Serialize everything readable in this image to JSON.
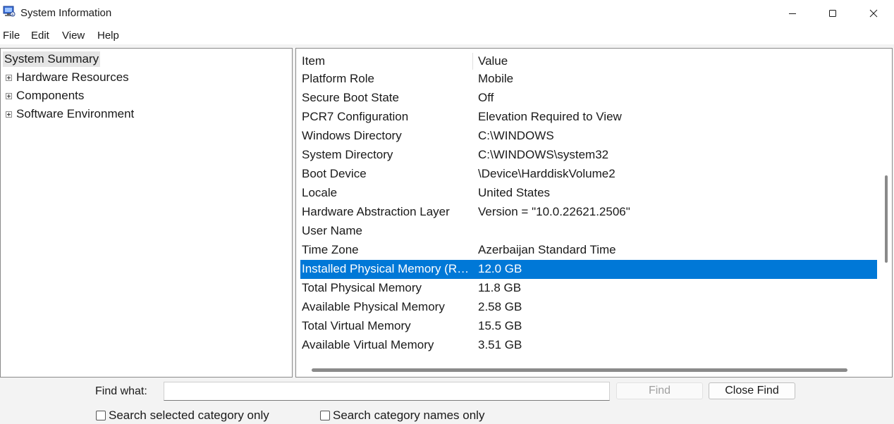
{
  "window": {
    "title": "System Information",
    "icon": "system-information-icon"
  },
  "menu": [
    "File",
    "Edit",
    "View",
    "Help"
  ],
  "tree": {
    "root": "System Summary",
    "children": [
      "Hardware Resources",
      "Components",
      "Software Environment"
    ]
  },
  "table": {
    "headers": {
      "item": "Item",
      "value": "Value"
    },
    "rows": [
      {
        "item": "Platform Role",
        "value": "Mobile"
      },
      {
        "item": "Secure Boot State",
        "value": "Off"
      },
      {
        "item": "PCR7 Configuration",
        "value": "Elevation Required to View"
      },
      {
        "item": "Windows Directory",
        "value": "C:\\WINDOWS"
      },
      {
        "item": "System Directory",
        "value": "C:\\WINDOWS\\system32"
      },
      {
        "item": "Boot Device",
        "value": "\\Device\\HarddiskVolume2"
      },
      {
        "item": "Locale",
        "value": "United States"
      },
      {
        "item": "Hardware Abstraction Layer",
        "value": "Version = \"10.0.22621.2506\""
      },
      {
        "item": "User Name",
        "value": ""
      },
      {
        "item": "Time Zone",
        "value": "Azerbaijan Standard Time"
      },
      {
        "item": "Installed Physical Memory (RAM)",
        "value": "12.0 GB"
      },
      {
        "item": "Total Physical Memory",
        "value": "11.8 GB"
      },
      {
        "item": "Available Physical Memory",
        "value": "2.58 GB"
      },
      {
        "item": "Total Virtual Memory",
        "value": "15.5 GB"
      },
      {
        "item": "Available Virtual Memory",
        "value": "3.51 GB"
      }
    ],
    "selected_row": 10
  },
  "find": {
    "label": "Find what:",
    "value": "",
    "find_button": "Find",
    "close_button": "Close Find",
    "option_selected_category": "Search selected category only",
    "option_category_names": "Search category names only"
  },
  "colors": {
    "selection": "#0078d7"
  }
}
